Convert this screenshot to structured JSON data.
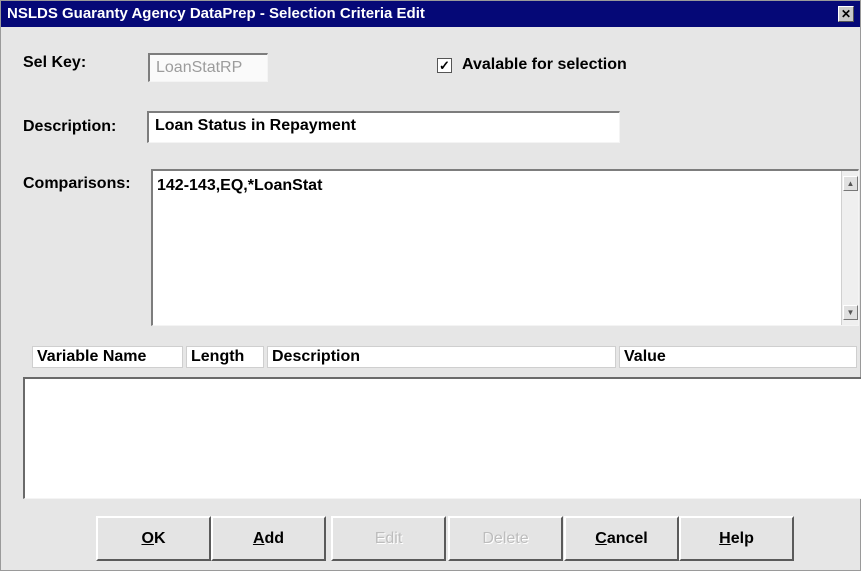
{
  "window": {
    "title": "NSLDS Guaranty Agency DataPrep - Selection Criteria Edit",
    "close_glyph": "✕"
  },
  "form": {
    "sel_key_label": "Sel Key:",
    "sel_key_value": "LoanStatRP",
    "available_label": "Avalable for selection",
    "available_checked": true,
    "checkmark": "✓",
    "description_label": "Description:",
    "description_value": "Loan Status in Repayment",
    "comparisons_label": "Comparisons:",
    "comparisons_value": "142-143,EQ,*LoanStat"
  },
  "variables_table": {
    "columns": [
      "Variable Name",
      "Length",
      "Description",
      "Value"
    ],
    "rows": []
  },
  "buttons": {
    "ok": {
      "accel": "O",
      "rest": "K",
      "enabled": true
    },
    "add": {
      "accel": "A",
      "rest": "dd",
      "enabled": true
    },
    "edit": {
      "label": "Edit",
      "enabled": false
    },
    "delete": {
      "label": "Delete",
      "enabled": false
    },
    "cancel": {
      "accel": "C",
      "rest": "ancel",
      "enabled": true
    },
    "help": {
      "accel": "H",
      "rest": "elp",
      "enabled": true
    }
  },
  "colors": {
    "titlebar": "#050877",
    "dialog_bg": "#e6e6e6"
  },
  "icons": {
    "close": "close-icon",
    "scroll_up": "scroll-up-arrow-icon",
    "scroll_down": "scroll-down-arrow-icon",
    "checkbox": "checkmark-icon"
  }
}
